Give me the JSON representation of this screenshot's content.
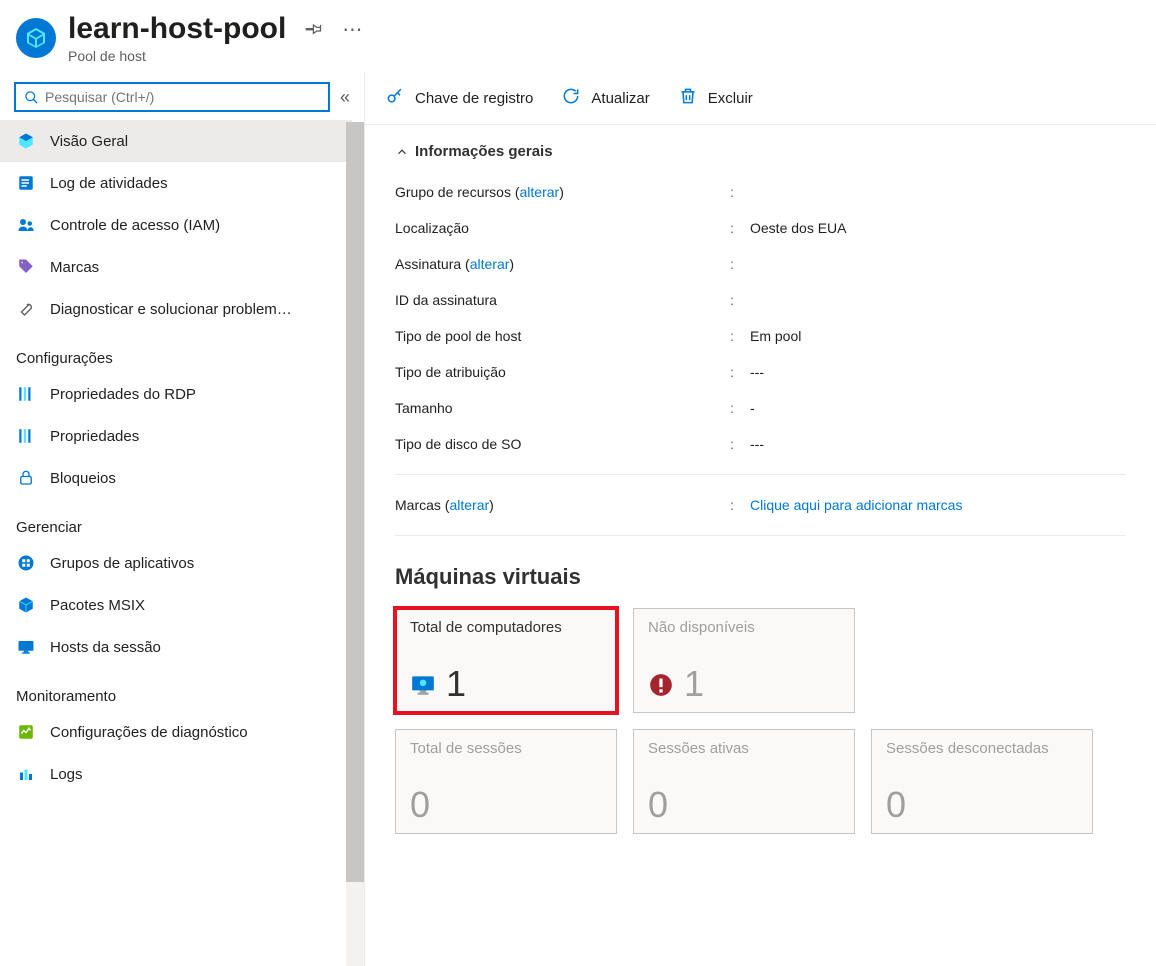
{
  "header": {
    "title": "learn-host-pool",
    "subtitle": "Pool de host"
  },
  "search": {
    "placeholder": "Pesquisar (Ctrl+/)"
  },
  "sidebar": {
    "items": [
      {
        "label": "Visão Geral"
      },
      {
        "label": "Log de atividades"
      },
      {
        "label": "Controle de acesso (IAM)"
      },
      {
        "label": "Marcas"
      },
      {
        "label": "Diagnosticar e solucionar problem…"
      }
    ],
    "sections": {
      "config_heading": "Configurações",
      "config_items": [
        {
          "label": "Propriedades do RDP"
        },
        {
          "label": "Propriedades"
        },
        {
          "label": "Bloqueios"
        }
      ],
      "manage_heading": "Gerenciar",
      "manage_items": [
        {
          "label": "Grupos de aplicativos"
        },
        {
          "label": "Pacotes MSIX"
        },
        {
          "label": "Hosts da sessão"
        }
      ],
      "monitor_heading": "Monitoramento",
      "monitor_items": [
        {
          "label": "Configurações de diagnóstico"
        },
        {
          "label": "Logs"
        }
      ]
    }
  },
  "toolbar": {
    "registration_key": "Chave de registro",
    "refresh": "Atualizar",
    "delete": "Excluir"
  },
  "essentials": {
    "section_title": "Informações gerais",
    "rows": {
      "resource_group": {
        "label": "Grupo de recursos",
        "link": "alterar",
        "value": ""
      },
      "location": {
        "label": "Localização",
        "value": "Oeste dos EUA"
      },
      "subscription": {
        "label": "Assinatura",
        "link": "alterar",
        "value": ""
      },
      "subscription_id": {
        "label": "ID da assinatura",
        "value": ""
      },
      "hostpool_type": {
        "label": "Tipo de pool de host",
        "value": "Em pool"
      },
      "assignment_type": {
        "label": "Tipo de atribuição",
        "value": "---"
      },
      "size": {
        "label": "Tamanho",
        "value": "-"
      },
      "os_disk_type": {
        "label": "Tipo de disco de SO",
        "value": "---"
      },
      "tags": {
        "label": "Marcas",
        "link": "alterar",
        "value_link": "Clique aqui para adicionar marcas"
      }
    }
  },
  "vm_section": {
    "heading": "Máquinas virtuais",
    "tiles": {
      "total_machines": {
        "label": "Total de computadores",
        "value": "1"
      },
      "unavailable": {
        "label": "Não disponíveis",
        "value": "1"
      },
      "total_sessions": {
        "label": "Total de sessões",
        "value": "0"
      },
      "active_sessions": {
        "label": "Sessões ativas",
        "value": "0"
      },
      "disconnected_sessions": {
        "label": "Sessões desconectadas",
        "value": "0"
      }
    }
  }
}
